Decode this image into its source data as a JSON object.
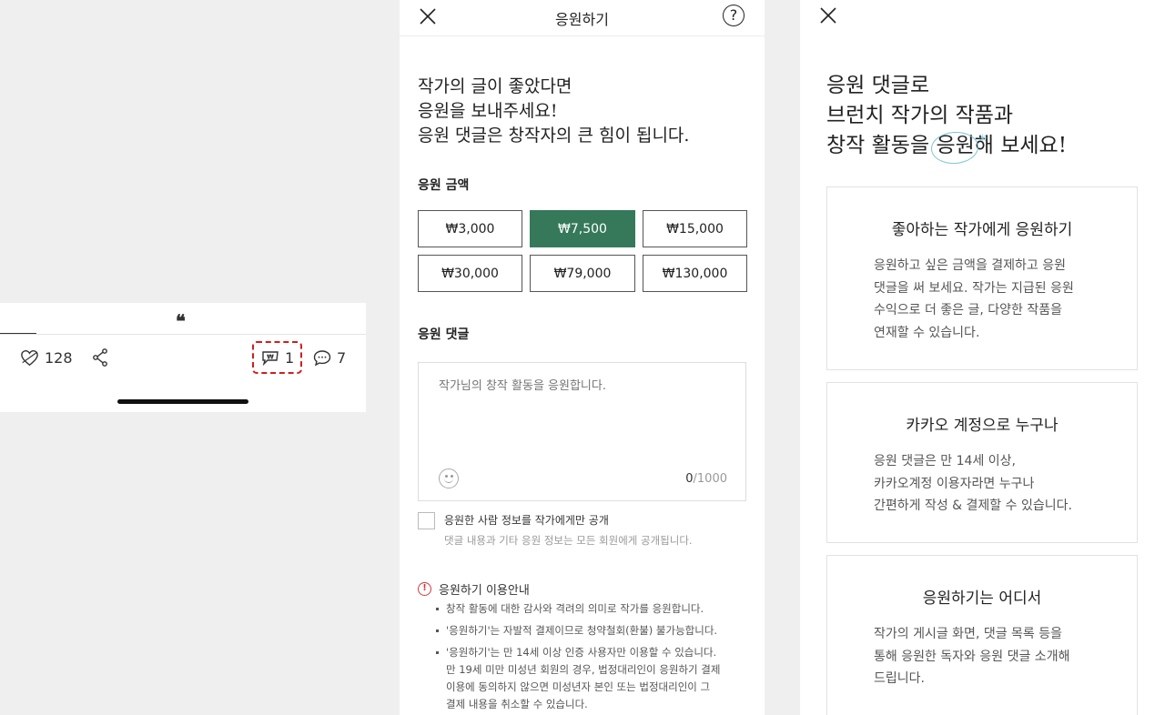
{
  "left": {
    "quote_mark": "❝",
    "like_count": "128",
    "cheer_count": "1",
    "comment_count": "7"
  },
  "middle": {
    "title": "응원하기",
    "help": "?",
    "intro": "작가의 글이 좋았다면\n응원을 보내주세요!\n응원 댓글은 창작자의 큰 힘이 됩니다.",
    "amount_label": "응원 금액",
    "amounts": [
      "₩3,000",
      "₩7,500",
      "₩15,000",
      "₩30,000",
      "₩79,000",
      "₩130,000"
    ],
    "selected_amount": "₩7,500",
    "comment_label": "응원 댓글",
    "comment_placeholder": "작가님의 창작 활동을 응원합니다.",
    "char_count": "0",
    "char_max": "/1000",
    "checkbox_label": "응원한 사람 정보를 작가에게만 공개",
    "checkbox_sub": "댓글 내용과 기타 응원 정보는 모든 회원에게 공개됩니다.",
    "notice_title": "응원하기 이용안내",
    "notice_items": [
      "창작 활동에 대한 감사와 격려의 의미로 작가를 응원합니다.",
      "'응원하기'는 자발적 결제이므로 청약철회(환불) 불가능합니다.",
      "'응원하기'는 만 14세 이상 인증 사용자만 이용할 수 있습니다.\n만 19세 미만 미성년 회원의 경우, 법정대리인이 응원하기 결제\n이용에 동의하지 않으면 미성년자 본인 또는 법정대리인이 그\n결제 내용을 취소할 수 있습니다."
    ]
  },
  "right": {
    "headline_line1": "응원 댓글로",
    "headline_line2": "브런치 작가의 작품과",
    "headline_line3_pre": "창작 활동을 ",
    "headline_line3_circled": "응원",
    "headline_line3_post": "해 보세요!",
    "cards": [
      {
        "title": "좋아하는 작가에게 응원하기",
        "body": "응원하고 싶은 금액을 결제하고 응원\n댓글을 써 보세요. 작가는 지급된 응원\n수익으로 더 좋은 글, 다양한 작품을\n연재할 수 있습니다."
      },
      {
        "title": "카카오 계정으로 누구나",
        "body": "응원 댓글은 만 14세 이상,\n카카오계정 이용자라면 누구나\n간편하게 작성 & 결제할 수 있습니다."
      },
      {
        "title": "응원하기는 어디서",
        "body": "작가의 게시글 화면, 댓글 목록 등을\n통해 응원한 독자와 응원 댓글 소개해\n드립니다."
      }
    ]
  },
  "colors": {
    "selected_amount_bg": "#35795a",
    "highlight_box": "#d21d1d",
    "circle_accent": "#7cc4d6",
    "warning": "#d4393a"
  }
}
